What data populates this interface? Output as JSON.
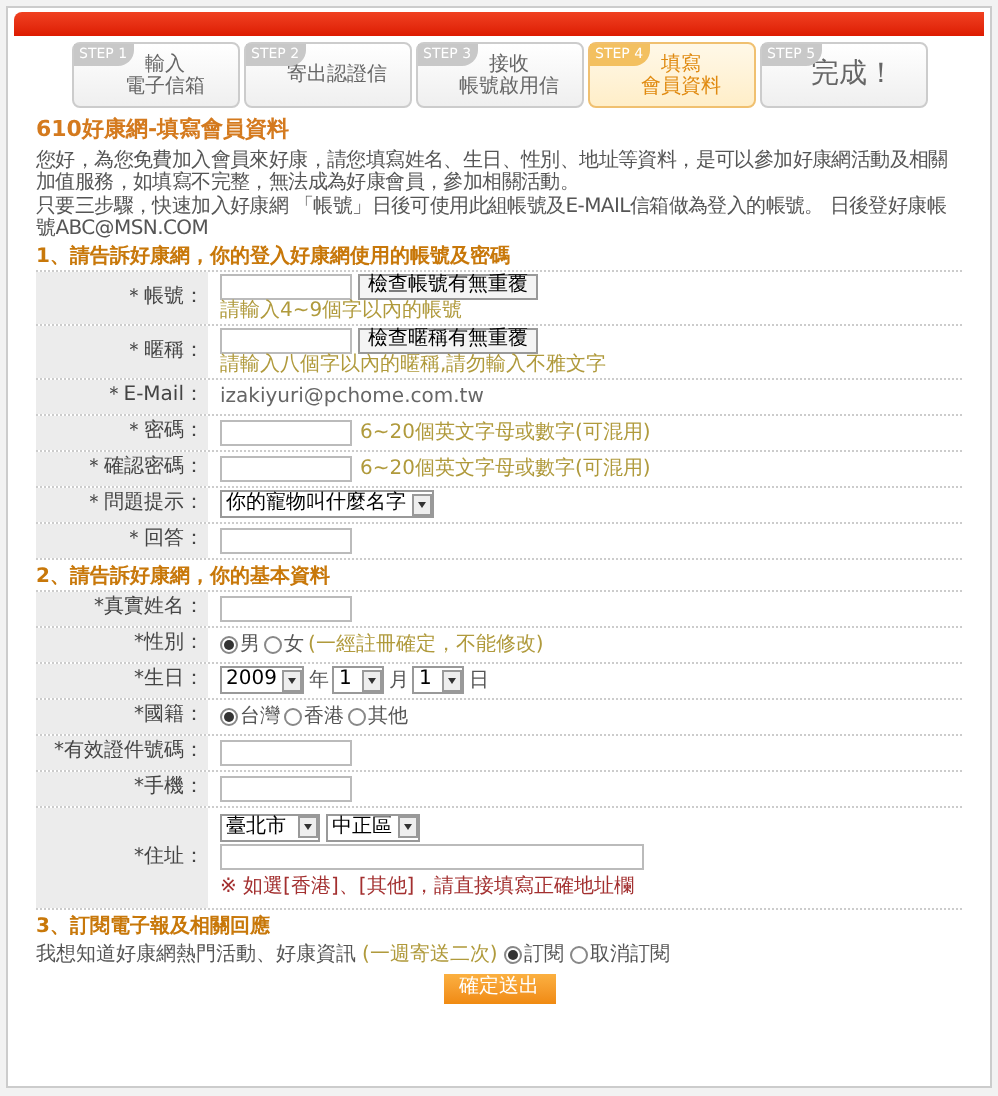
{
  "steps": [
    {
      "tag": "STEP 1",
      "lines": [
        "輸入",
        "電子信箱"
      ],
      "selected": false
    },
    {
      "tag": "STEP 2",
      "lines": [
        "寄出認證信"
      ],
      "selected": false
    },
    {
      "tag": "STEP 3",
      "lines": [
        "接收",
        "帳號啟用信"
      ],
      "selected": false
    },
    {
      "tag": "STEP 4",
      "lines": [
        "填寫",
        "會員資料"
      ],
      "selected": true
    },
    {
      "tag": "STEP 5",
      "lines": [
        "完成！"
      ],
      "selected": false
    }
  ],
  "title": "610好康網-填寫會員資料",
  "intro": [
    "您好，為您免費加入會員來好康，請您填寫姓名、生日、性別、地址等資料，是可以參加好康網活動及相關加值服務，如填寫不完整，無法成為好康會員，參加相關活動。",
    "只要三步驟，快速加入好康網 「帳號」日後可使用此組帳號及E-MAIL信箱做為登入的帳號。 日後登好康帳號ABC@MSN.COM"
  ],
  "sections": [
    {
      "heading": "1、請告訴好康網，你的登入好康網使用的帳號及密碼",
      "rows": [
        {
          "kind": "check",
          "label": "＊帳號：",
          "button": "檢查帳號有無重覆",
          "hint": "請輸入4~9個字以內的帳號"
        },
        {
          "kind": "check",
          "label": "＊暱稱：",
          "button": "檢查暱稱有無重覆",
          "hint": "請輸入八個字以內的暱稱,請勿輸入不雅文字"
        },
        {
          "kind": "static",
          "label": "＊E-Mail：",
          "value": "izakiyuri@pchome.com.tw"
        },
        {
          "kind": "input",
          "label": "＊密碼：",
          "hint": "6~20個英文字母或數字(可混用)"
        },
        {
          "kind": "input",
          "label": "＊確認密碼：",
          "hint": "6~20個英文字母或數字(可混用)"
        },
        {
          "kind": "select",
          "label": "＊問題提示：",
          "value": "你的寵物叫什麼名字"
        },
        {
          "kind": "input",
          "label": "＊回答："
        }
      ]
    },
    {
      "heading": "2、請告訴好康網，你的基本資料",
      "rows": [
        {
          "kind": "input",
          "label": "*真實姓名："
        },
        {
          "kind": "radio",
          "label": "*性別：",
          "options": [
            {
              "label": "男",
              "selected": true
            },
            {
              "label": "女",
              "selected": false
            }
          ],
          "hint": "(一經註冊確定，不能修改)"
        },
        {
          "kind": "date",
          "label": "*生日：",
          "parts": [
            {
              "value": "2009",
              "unit": "年"
            },
            {
              "value": "1",
              "unit": "月"
            },
            {
              "value": "1",
              "unit": "日"
            }
          ]
        },
        {
          "kind": "radio",
          "label": "*國籍：",
          "options": [
            {
              "label": "台灣",
              "selected": true
            },
            {
              "label": "香港",
              "selected": false
            },
            {
              "label": "其他",
              "selected": false
            }
          ]
        },
        {
          "kind": "input",
          "label": "*有效證件號碼："
        },
        {
          "kind": "input",
          "label": "*手機："
        },
        {
          "kind": "address",
          "label": "*住址：",
          "selects": [
            "臺北市",
            "中正區"
          ],
          "note": "※ 如選[香港]、[其他]，請直接填寫正確地址欄"
        }
      ]
    }
  ],
  "subscribe": {
    "heading": "3、訂閱電子報及相關回應",
    "text": "我想知道好康網熱門活動、好康資訊",
    "hint": "(一週寄送二次)",
    "options": [
      {
        "label": "訂閱",
        "selected": true
      },
      {
        "label": "取消訂閱",
        "selected": false
      }
    ]
  },
  "submit": "確定送出"
}
